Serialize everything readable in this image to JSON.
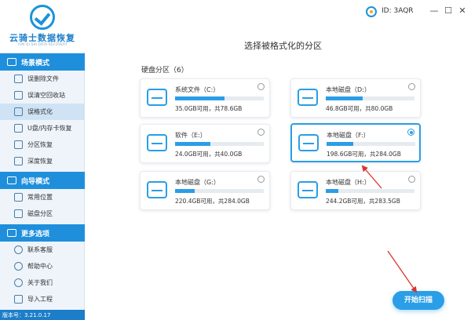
{
  "app": {
    "logo_title": "云骑士数据恢复",
    "logo_subtitle": "YUN QI SHI DATA RECOVERY"
  },
  "header": {
    "user_id": "ID: 3AQR",
    "minimize": "—",
    "maximize": "☐",
    "close": "✕"
  },
  "sidebar": {
    "sections": [
      {
        "title": "场景模式",
        "items": [
          {
            "label": "误删除文件"
          },
          {
            "label": "误清空回收站"
          },
          {
            "label": "误格式化",
            "active": true
          },
          {
            "label": "U盘/内存卡恢复"
          },
          {
            "label": "分区恢复"
          },
          {
            "label": "深度恢复"
          }
        ]
      },
      {
        "title": "向导模式",
        "items": [
          {
            "label": "常用位置"
          },
          {
            "label": "磁盘分区"
          }
        ]
      },
      {
        "title": "更多选项",
        "items": [
          {
            "label": "联系客服"
          },
          {
            "label": "帮助中心"
          },
          {
            "label": "关于我们"
          },
          {
            "label": "导入工程"
          }
        ]
      }
    ],
    "version": "版本号：3.21.0.17"
  },
  "main": {
    "title": "选择被格式化的分区",
    "group_label": "硬盘分区（6）",
    "disks": [
      {
        "name": "系统文件（C:）",
        "capacity": "35.0GB可用，共78.6GB",
        "used_fraction": 0.555,
        "selected": false
      },
      {
        "name": "本地磁盘（D:）",
        "capacity": "46.8GB可用，共80.0GB",
        "used_fraction": 0.415,
        "selected": false
      },
      {
        "name": "软件（E:）",
        "capacity": "24.0GB可用，共40.0GB",
        "used_fraction": 0.4,
        "selected": false
      },
      {
        "name": "本地磁盘（F:）",
        "capacity": "198.6GB可用，共284.0GB",
        "used_fraction": 0.3,
        "selected": true
      },
      {
        "name": "本地磁盘（G:）",
        "capacity": "220.4GB可用，共284.0GB",
        "used_fraction": 0.224,
        "selected": false
      },
      {
        "name": "本地磁盘（H:）",
        "capacity": "244.2GB可用，共283.5GB",
        "used_fraction": 0.139,
        "selected": false
      }
    ],
    "start_button": "开始扫描"
  },
  "colors": {
    "accent": "#2a9ee6",
    "sidebar_header": "#1f8fdc",
    "annotation_arrow": "#d9342b"
  }
}
